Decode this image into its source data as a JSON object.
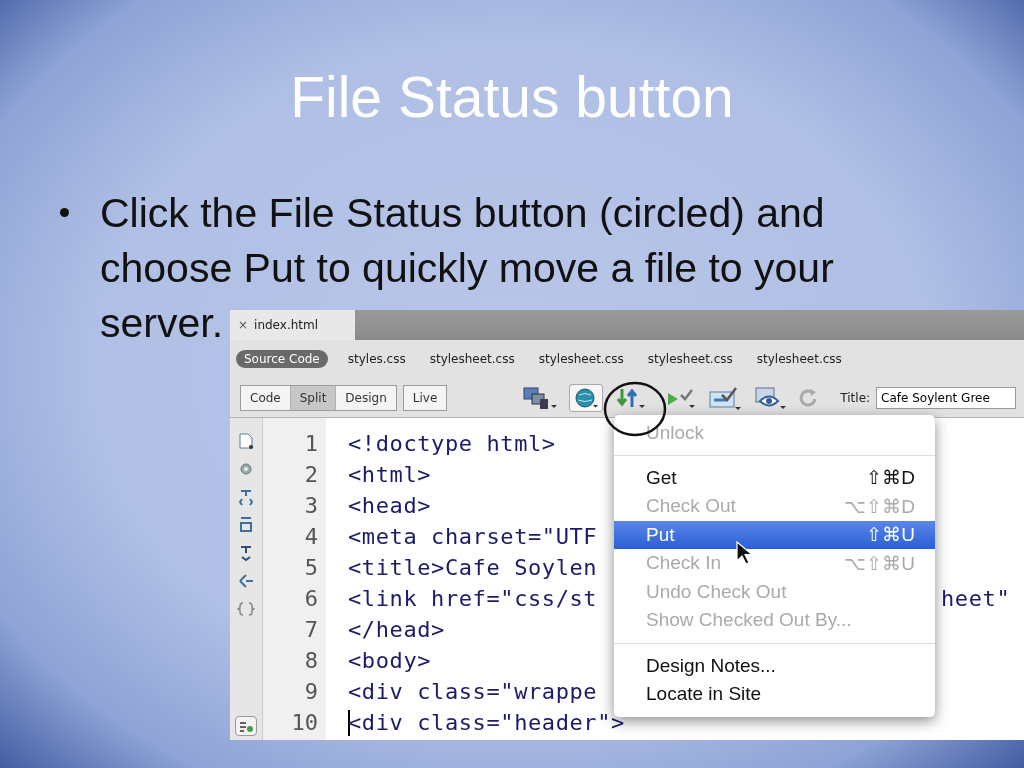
{
  "slide": {
    "title": "File Status button",
    "bullets": [
      {
        "lines": [
          "Click the File Status button (circled) and",
          "choose Put to quickly move a file to your",
          "server."
        ]
      }
    ]
  },
  "screenshot": {
    "document_tabs": [
      {
        "close": "×",
        "label": "index.html",
        "selected": true
      }
    ],
    "related_files": [
      {
        "label": "Source Code",
        "selected": true
      },
      {
        "label": "styles.css",
        "selected": false
      },
      {
        "label": "stylesheet.css",
        "selected": false
      },
      {
        "label": "stylesheet.css",
        "selected": false
      },
      {
        "label": "stylesheet.css",
        "selected": false
      },
      {
        "label": "stylesheet.css",
        "selected": false
      }
    ],
    "view_buttons": [
      {
        "label": "Code",
        "selected": false
      },
      {
        "label": "Split",
        "selected": true
      },
      {
        "label": "Design",
        "selected": false
      }
    ],
    "live_button": {
      "label": "Live"
    },
    "title_field": {
      "label": "Title:",
      "value": "Cafe Soylent Gree"
    },
    "code_lines": [
      {
        "number": "1",
        "text": "<!doctype html>",
        "cursor": false
      },
      {
        "number": "2",
        "text": "<html>",
        "cursor": false
      },
      {
        "number": "3",
        "text": "<head>",
        "cursor": false
      },
      {
        "number": "4",
        "text": "<meta charset=\"UTF",
        "cursor": false
      },
      {
        "number": "5",
        "text": "<title>Cafe Soylen",
        "cursor": false
      },
      {
        "number": "6",
        "text": "<link href=\"css/st",
        "tail": "heet\"",
        "cursor": false
      },
      {
        "number": "7",
        "text": "</head>",
        "cursor": false
      },
      {
        "number": "8",
        "text": "<body>",
        "cursor": false
      },
      {
        "number": "9",
        "text": "<div class=\"wrappe",
        "cursor": false
      },
      {
        "number": "10",
        "text": "<div class=\"header\">",
        "cursor": true
      }
    ],
    "file_status_menu": {
      "items": [
        {
          "kind": "item",
          "label": "Unlock",
          "disabled": true,
          "selected": false
        },
        {
          "kind": "separator"
        },
        {
          "kind": "item",
          "label": "Get",
          "shortcut": "⇧⌘D",
          "disabled": false,
          "selected": false
        },
        {
          "kind": "item",
          "label": "Check Out",
          "shortcut": "⌥⇧⌘D",
          "disabled": true,
          "selected": false
        },
        {
          "kind": "item",
          "label": "Put",
          "shortcut": "⇧⌘U",
          "disabled": false,
          "selected": true
        },
        {
          "kind": "item",
          "label": "Check In",
          "shortcut": "⌥⇧⌘U",
          "disabled": true,
          "selected": false
        },
        {
          "kind": "item",
          "label": "Undo Check Out",
          "disabled": true,
          "selected": false
        },
        {
          "kind": "item",
          "label": "Show Checked Out By...",
          "disabled": true,
          "selected": false
        },
        {
          "kind": "separator"
        },
        {
          "kind": "item",
          "label": "Design Notes...",
          "disabled": false,
          "selected": false
        },
        {
          "kind": "item",
          "label": "Locate in Site",
          "disabled": false,
          "selected": false
        }
      ]
    }
  }
}
